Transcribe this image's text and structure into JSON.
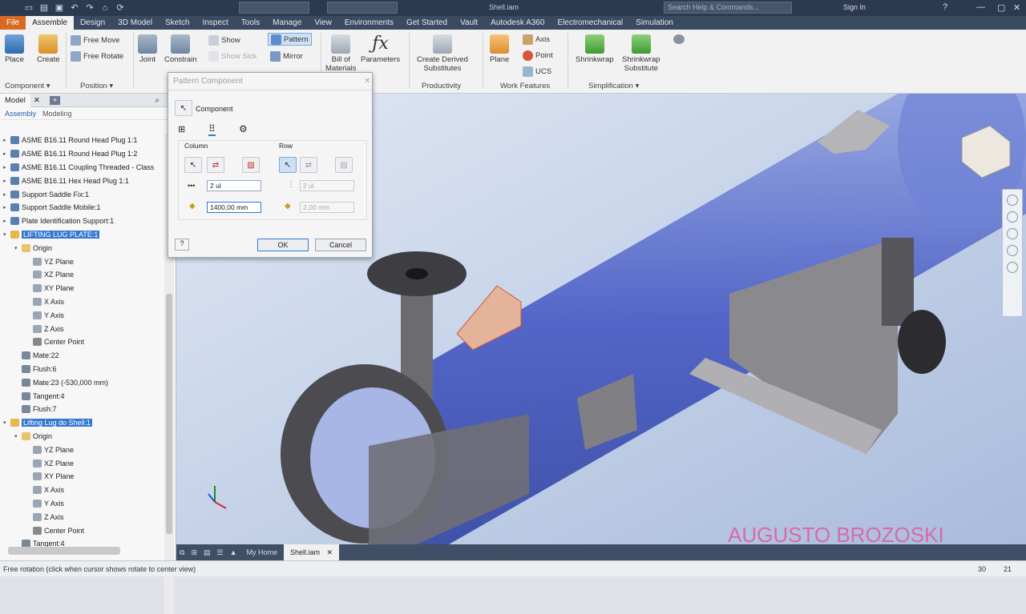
{
  "titlebar": {
    "doc_title": "Shell.iam",
    "search_placeholder": "Search Help & Commands...",
    "sign_in": "Sign In",
    "help": "?"
  },
  "tabs": [
    "File",
    "Assemble",
    "Design",
    "3D Model",
    "Sketch",
    "Inspect",
    "Tools",
    "Manage",
    "View",
    "Environments",
    "Get Started",
    "Vault",
    "Autodesk A360",
    "Electromechanical",
    "Simulation"
  ],
  "ribbon": {
    "place": "Place",
    "create": "Create",
    "free_move": "Free Move",
    "free_rotate": "Free Rotate",
    "joint": "Joint",
    "constrain": "Constrain",
    "show": "Show",
    "show_sick": "Show Sick",
    "pattern": "Pattern",
    "mirror": "Mirror",
    "bill_of": "Bill of",
    "materials": "Materials",
    "parameters": "Parameters",
    "create_derived": "Create Derived",
    "substitutes": "Substitutes",
    "plane": "Plane",
    "axis": "Axis",
    "point": "Point",
    "ucs": "UCS",
    "shrinkwrap": "Shrinkwrap",
    "shrinkwrap_sub": "Shrinkwrap",
    "substitute": "Substitute",
    "panels": {
      "component": "Component ▾",
      "position": "Position ▾",
      "productivity": "Productivity",
      "work_features": "Work Features",
      "simplification": "Simplification ▾"
    }
  },
  "browser": {
    "tab_model": "Model",
    "close": "✕",
    "add": "+",
    "sub_assembly": "Assembly",
    "sub_modeling": "Modeling",
    "tree": [
      {
        "label": "ASME B16.11 Round Head Plug 1:1",
        "indent": 0,
        "kind": "part"
      },
      {
        "label": "ASME B16.11 Round Head Plug 1:2",
        "indent": 0,
        "kind": "part"
      },
      {
        "label": "ASME B16.11 Coupling Threaded - Class",
        "indent": 0,
        "kind": "part"
      },
      {
        "label": "ASME B16.11 Hex Head Plug 1:1",
        "indent": 0,
        "kind": "part"
      },
      {
        "label": "Support Saddle Fix:1",
        "indent": 0,
        "kind": "part"
      },
      {
        "label": "Support Saddle Mobile:1",
        "indent": 0,
        "kind": "part"
      },
      {
        "label": "Plate Identification Support:1",
        "indent": 0,
        "kind": "part"
      },
      {
        "label": "LIFTING LUG PLATE:1",
        "indent": 0,
        "kind": "sel"
      },
      {
        "label": "Origin",
        "indent": 1,
        "kind": "folder"
      },
      {
        "label": "YZ Plane",
        "indent": 2,
        "kind": "plane"
      },
      {
        "label": "XZ Plane",
        "indent": 2,
        "kind": "plane"
      },
      {
        "label": "XY Plane",
        "indent": 2,
        "kind": "plane"
      },
      {
        "label": "X Axis",
        "indent": 2,
        "kind": "plane"
      },
      {
        "label": "Y Axis",
        "indent": 2,
        "kind": "plane"
      },
      {
        "label": "Z Axis",
        "indent": 2,
        "kind": "plane"
      },
      {
        "label": "Center Point",
        "indent": 2,
        "kind": "point"
      },
      {
        "label": "Mate:22",
        "indent": 1,
        "kind": "con"
      },
      {
        "label": "Flush:6",
        "indent": 1,
        "kind": "con"
      },
      {
        "label": "Mate:23 (-530,000 mm)",
        "indent": 1,
        "kind": "con"
      },
      {
        "label": "Tangent:4",
        "indent": 1,
        "kind": "con"
      },
      {
        "label": "Flush:7",
        "indent": 1,
        "kind": "con"
      },
      {
        "label": "Lifting Lug do Shell:1",
        "indent": 0,
        "kind": "sel"
      },
      {
        "label": "Origin",
        "indent": 1,
        "kind": "folder"
      },
      {
        "label": "YZ Plane",
        "indent": 2,
        "kind": "plane"
      },
      {
        "label": "XZ Plane",
        "indent": 2,
        "kind": "plane"
      },
      {
        "label": "XY Plane",
        "indent": 2,
        "kind": "plane"
      },
      {
        "label": "X Axis",
        "indent": 2,
        "kind": "plane"
      },
      {
        "label": "Y Axis",
        "indent": 2,
        "kind": "plane"
      },
      {
        "label": "Z Axis",
        "indent": 2,
        "kind": "plane"
      },
      {
        "label": "Center Point",
        "indent": 2,
        "kind": "point"
      },
      {
        "label": "Tangent:4",
        "indent": 1,
        "kind": "con"
      }
    ]
  },
  "dialog": {
    "title": "Pattern Component",
    "component": "Component",
    "column": "Column",
    "row": "Row",
    "col_count": "2 ul",
    "col_dist": "1400,00 mm",
    "row_count": "2 ul",
    "row_dist": "2,00 mm",
    "ok": "OK",
    "cancel": "Cancel"
  },
  "doctabs": {
    "home": "My Home",
    "shell": "Shell.iam"
  },
  "watermark": "AUGUSTO BROZOSKI",
  "status": {
    "text": "Free rotation (click when cursor shows rotate to center view)",
    "n1": "30",
    "n2": "21"
  }
}
